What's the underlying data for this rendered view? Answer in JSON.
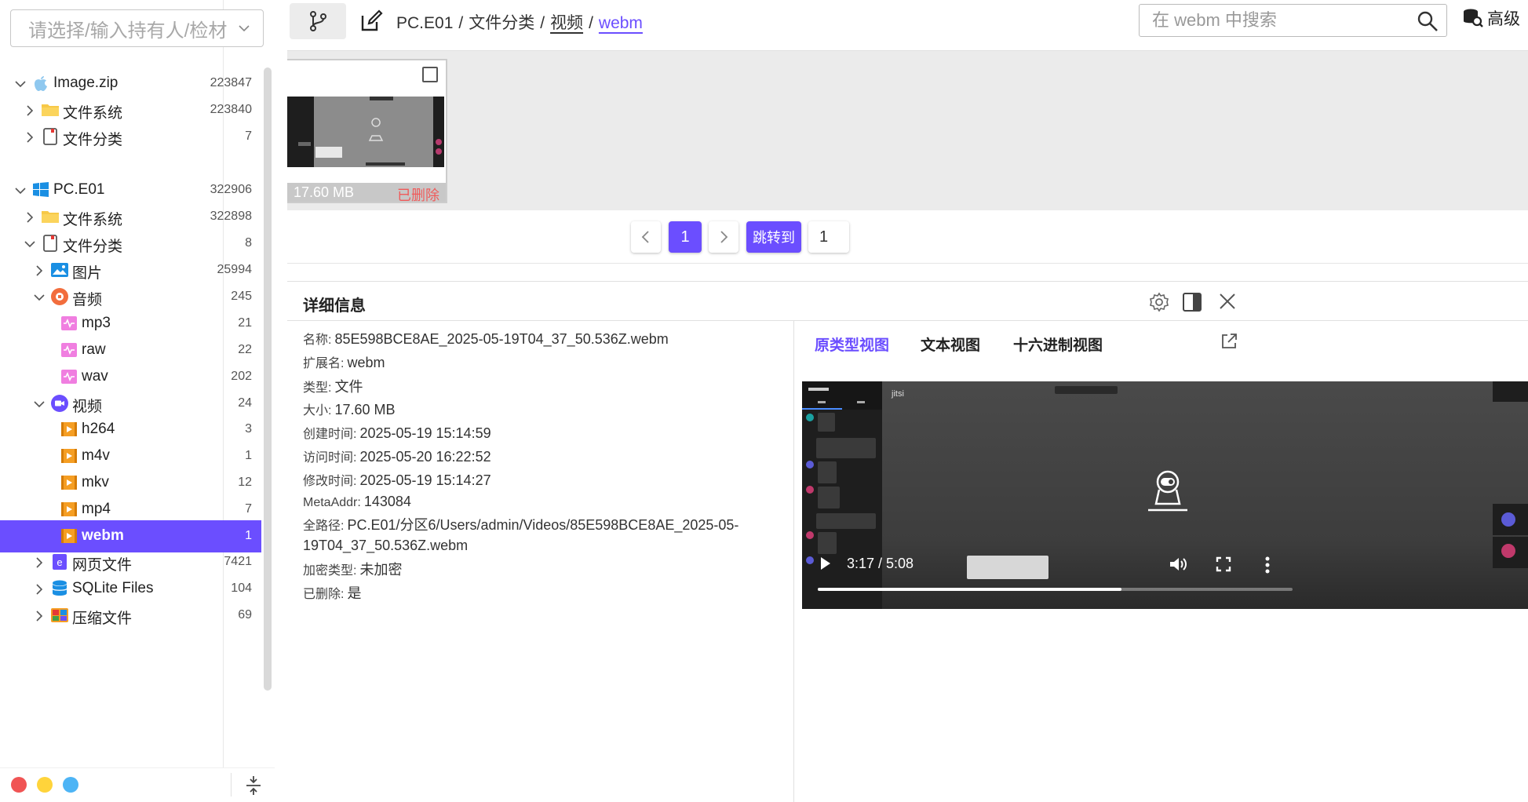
{
  "sidebar": {
    "owner_placeholder": "请选择/输入持有人/检材",
    "tree": [
      {
        "label": "Image.zip",
        "count": "223847",
        "depth": 0,
        "expanded": true,
        "icon": "apple-icon"
      },
      {
        "label": "文件系统",
        "count": "223840",
        "depth": 1,
        "expanded": false,
        "icon": "folder-icon"
      },
      {
        "label": "文件分类",
        "count": "7",
        "depth": 1,
        "expanded": false,
        "icon": "category-icon"
      },
      {
        "label": "PC.E01",
        "count": "322906",
        "depth": 0,
        "expanded": true,
        "icon": "windows-icon"
      },
      {
        "label": "文件系统",
        "count": "322898",
        "depth": 1,
        "expanded": false,
        "icon": "folder-icon"
      },
      {
        "label": "文件分类",
        "count": "8",
        "depth": 1,
        "expanded": true,
        "icon": "category-icon"
      },
      {
        "label": "图片",
        "count": "25994",
        "depth": 2,
        "expanded": false,
        "icon": "image-icon"
      },
      {
        "label": "音频",
        "count": "245",
        "depth": 2,
        "expanded": true,
        "icon": "audio-icon"
      },
      {
        "label": "mp3",
        "count": "21",
        "depth": 3,
        "icon": "audio-file-icon"
      },
      {
        "label": "raw",
        "count": "22",
        "depth": 3,
        "icon": "audio-file-icon"
      },
      {
        "label": "wav",
        "count": "202",
        "depth": 3,
        "icon": "audio-file-icon"
      },
      {
        "label": "视频",
        "count": "24",
        "depth": 2,
        "expanded": true,
        "icon": "video-icon"
      },
      {
        "label": "h264",
        "count": "3",
        "depth": 3,
        "icon": "video-file-icon"
      },
      {
        "label": "m4v",
        "count": "1",
        "depth": 3,
        "icon": "video-file-icon"
      },
      {
        "label": "mkv",
        "count": "12",
        "depth": 3,
        "icon": "video-file-icon"
      },
      {
        "label": "mp4",
        "count": "7",
        "depth": 3,
        "icon": "video-file-icon"
      },
      {
        "label": "webm",
        "count": "1",
        "depth": 3,
        "icon": "video-file-icon",
        "selected": true
      },
      {
        "label": "网页文件",
        "count": "7421",
        "depth": 2,
        "expanded": false,
        "icon": "web-file-icon"
      },
      {
        "label": "SQLite Files",
        "count": "104",
        "depth": 2,
        "expanded": false,
        "icon": "database-icon"
      },
      {
        "label": "压缩文件",
        "count": "69",
        "depth": 2,
        "expanded": false,
        "icon": "archive-icon"
      }
    ]
  },
  "breadcrumb": [
    "PC.E01",
    "文件分类",
    "视频",
    "webm"
  ],
  "search": {
    "placeholder": "在 webm 中搜索",
    "value": ""
  },
  "advanced_label": "高级",
  "file_card": {
    "size": "17.60 MB",
    "status": "已删除"
  },
  "pager": {
    "current": "1",
    "jump_label": "跳转到",
    "jump_value": "1"
  },
  "detail": {
    "title": "详细信息",
    "props": [
      {
        "key": "名称:",
        "value": "85E598BCE8AE_2025-05-19T04_37_50.536Z.webm"
      },
      {
        "key": "扩展名:",
        "value": "webm"
      },
      {
        "key": "类型:",
        "value": "文件"
      },
      {
        "key": "大小:",
        "value": "17.60 MB"
      },
      {
        "key": "创建时间:",
        "value": "2025-05-19 15:14:59"
      },
      {
        "key": "访问时间:",
        "value": "2025-05-20 16:22:52"
      },
      {
        "key": "修改时间:",
        "value": "2025-05-19 15:14:27"
      },
      {
        "key": "MetaAddr:",
        "value": "143084"
      },
      {
        "key": "全路径:",
        "value": "PC.E01/分区6/Users/admin/Videos/85E598BCE8AE_2025-05-19T04_37_50.536Z.webm"
      },
      {
        "key": "加密类型:",
        "value": "未加密"
      },
      {
        "key": "已删除:",
        "value": "是"
      }
    ],
    "view_tabs": [
      "原类型视图",
      "文本视图",
      "十六进制视图"
    ],
    "active_view": 0
  },
  "video": {
    "brand": "jitsi",
    "current_time": "3:17",
    "duration": "5:08",
    "time_text": "3:17 / 5:08",
    "progress": 0.64
  },
  "colors": {
    "accent": "#6b4eff",
    "deleted": "#f05a5a",
    "dot_red": "#f05454",
    "dot_yellow": "#ffd43b",
    "dot_blue": "#4db4f5"
  }
}
